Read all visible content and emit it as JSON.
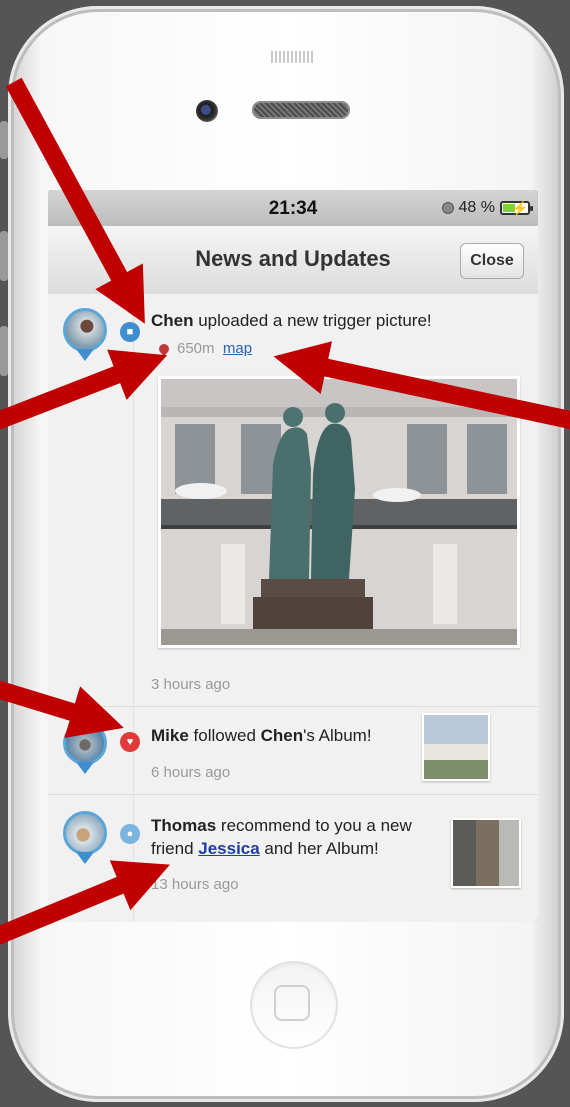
{
  "status_bar": {
    "time": "21:34",
    "battery": "48 %"
  },
  "nav": {
    "title": "News and Updates",
    "close": "Close"
  },
  "feed": [
    {
      "user": "Chen",
      "action": " uploaded a new trigger picture!",
      "distance": "650m",
      "map_label": "map",
      "time_ago": "3 hours ago",
      "badge_icon": "video-camera-icon"
    },
    {
      "user": "Mike",
      "action": " followed ",
      "target": "Chen",
      "action_end": "'s Album!",
      "time_ago": "6 hours ago",
      "badge_icon": "heart-icon"
    },
    {
      "user": "Thomas",
      "action": " recommend to you a new friend ",
      "friend": "Jessica",
      "action_end": " and her Album!",
      "time_ago": "13 hours ago",
      "badge_icon": "person-add-icon"
    }
  ],
  "colors": {
    "accent_blue": "#3e8ed0",
    "annotation_red": "#c00000",
    "heart_red": "#e03a3a"
  }
}
